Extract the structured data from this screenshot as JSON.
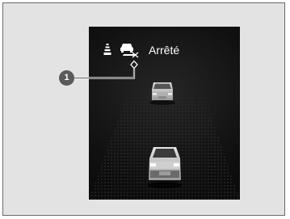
{
  "status": {
    "label": "Arrêté"
  },
  "callouts": [
    {
      "number": "1"
    }
  ],
  "icons": {
    "lane": "lane-icon",
    "follow_car": "follow-car-icon",
    "lead_vehicle": "lead-vehicle-icon",
    "own_vehicle": "own-vehicle-icon"
  },
  "colors": {
    "screen_background": "#111111",
    "frame_background": "#e3e3e3",
    "callout_fill": "#5a5a5a"
  }
}
